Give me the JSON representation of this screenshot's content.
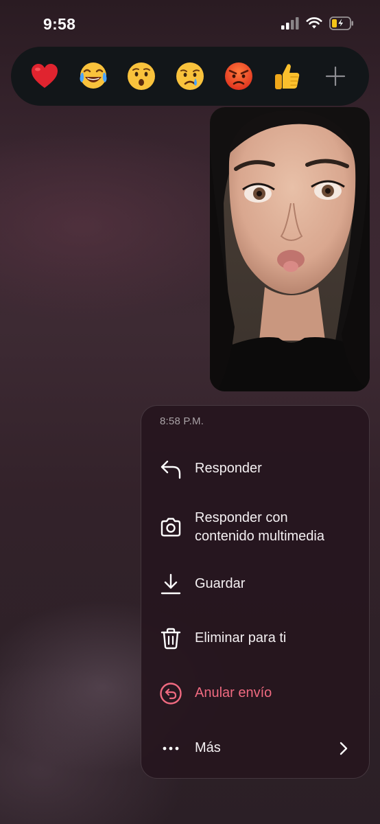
{
  "status_bar": {
    "time": "9:58"
  },
  "reactions": [
    {
      "name": "heart",
      "icon": "red-heart-emoji"
    },
    {
      "name": "tears-of-joy",
      "icon": "face-with-tears-of-joy-emoji"
    },
    {
      "name": "surprised",
      "icon": "hushed-face-emoji"
    },
    {
      "name": "crying",
      "icon": "crying-face-emoji"
    },
    {
      "name": "angry",
      "icon": "angry-face-emoji"
    },
    {
      "name": "thumbs-up",
      "icon": "thumbs-up-emoji"
    },
    {
      "name": "more",
      "icon": "plus-icon"
    }
  ],
  "context_menu": {
    "timestamp": "8:58 P.M.",
    "items": [
      {
        "label": "Responder",
        "icon": "reply-arrow-icon"
      },
      {
        "label_line1": "Responder con",
        "label_line2": "contenido multimedia",
        "icon": "camera-icon"
      },
      {
        "label": "Guardar",
        "icon": "download-icon"
      },
      {
        "label": "Eliminar para ti",
        "icon": "trash-icon"
      },
      {
        "label": "Anular envío",
        "icon": "unsend-icon",
        "color": "#f06a80"
      },
      {
        "label": "Más",
        "icon": "more-dots-icon"
      }
    ]
  },
  "colors": {
    "danger": "#f06a80",
    "menu_background": "#26161e",
    "reaction_bar": "#121619"
  }
}
